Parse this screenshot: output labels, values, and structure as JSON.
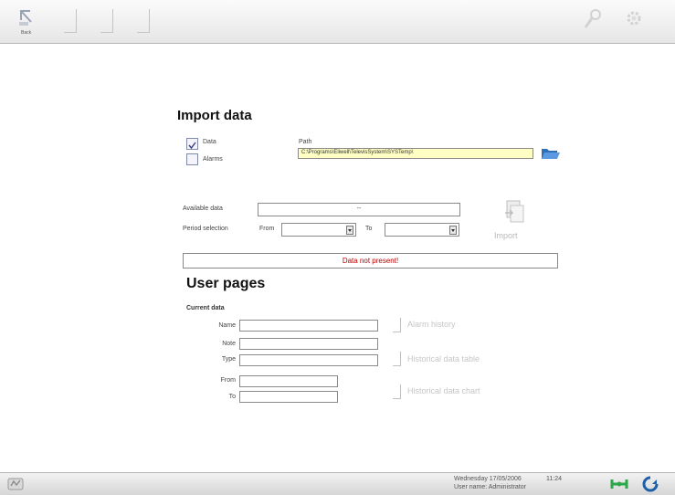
{
  "toolbar": {
    "back_label": "Back"
  },
  "import_section": {
    "title": "Import data",
    "data_option": "Data",
    "alarms_option": "Alarms",
    "path_label": "Path",
    "path_value": "C:\\Programs\\Eliwell\\TelevisSystem\\SYSTemp\\",
    "available_data_label": "Available data",
    "available_data_value": "--",
    "period_selection_label": "Period selection",
    "from_label": "From",
    "to_label": "To",
    "import_label": "Import",
    "message": "Data not present!"
  },
  "user_pages": {
    "title": "User pages",
    "current_data_label": "Current data",
    "name_label": "Name",
    "note_label": "Note",
    "type_label": "Type",
    "from_label": "From",
    "to_label": "To",
    "alarm_history_label": "Alarm history",
    "historical_table_label": "Historical data table",
    "historical_chart_label": "Historical data chart"
  },
  "statusbar": {
    "date": "Wednesday  17/05/2006",
    "time": "11:24",
    "user": "User name: Administrator"
  },
  "colors": {
    "path_bg": "#ffffc4",
    "message_text": "#b40000",
    "connect_icon": "#2ca84a",
    "refresh_icon": "#1d5fa8"
  }
}
